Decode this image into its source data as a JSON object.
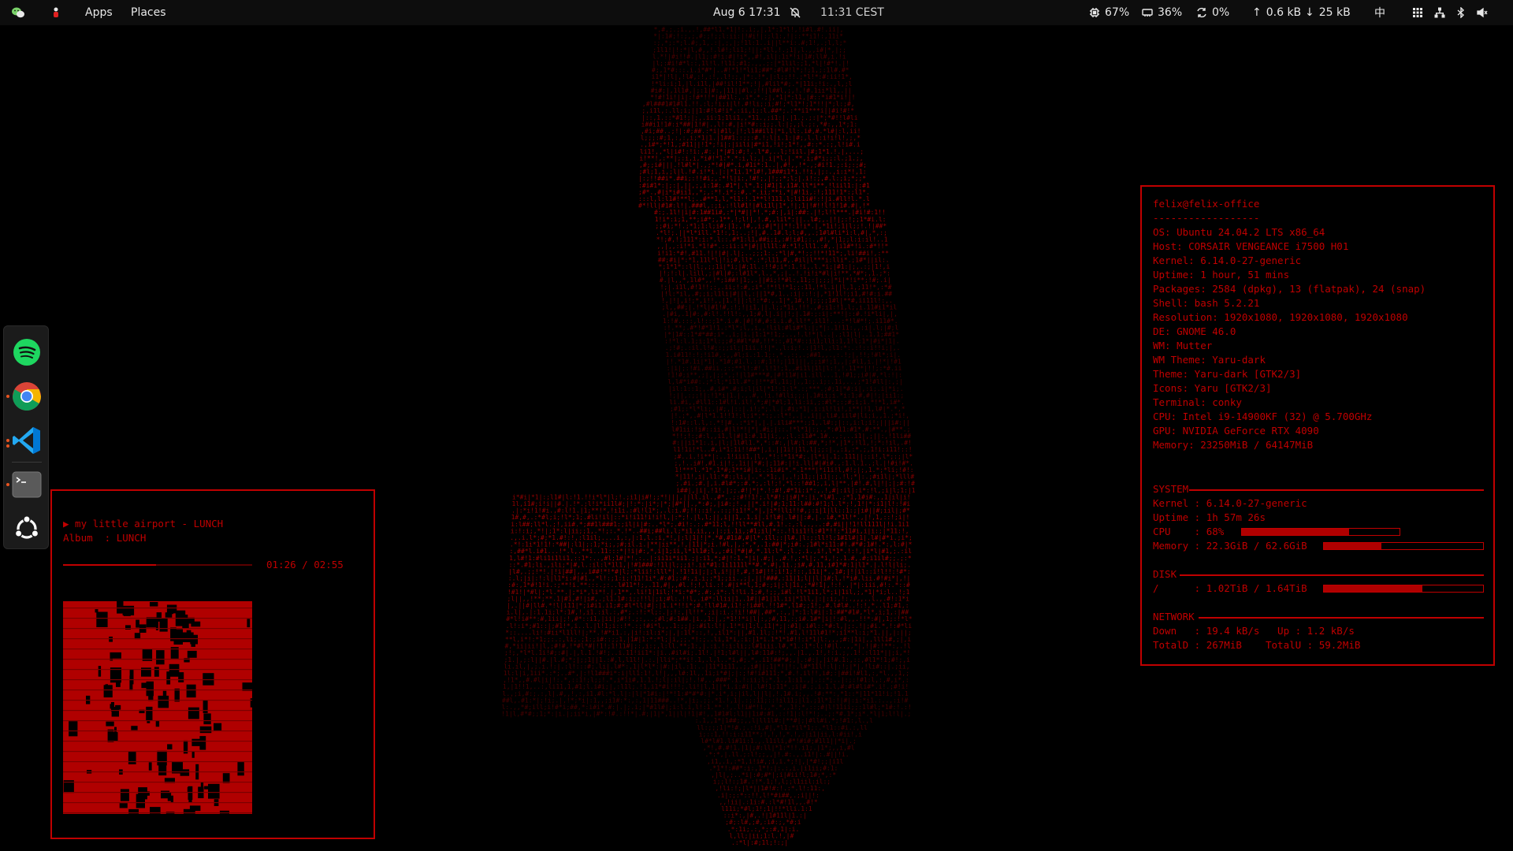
{
  "topbar": {
    "apps_label": "Apps",
    "places_label": "Places",
    "datetime": "Aug 6  17:31",
    "second_clock": "11:31 CEST",
    "tray": {
      "cpu": "67%",
      "ram": "36%",
      "swap": "0%",
      "upload": "0.6 kB",
      "download": "25 kB",
      "input_method": "中"
    }
  },
  "dock": {
    "apps": [
      {
        "name": "spotify-icon",
        "running": false
      },
      {
        "name": "chrome-icon",
        "running": true
      },
      {
        "name": "vscode-icon",
        "running": true
      },
      {
        "name": "terminal-icon",
        "running": true
      },
      {
        "name": "ubuntu-icon",
        "running": false
      }
    ]
  },
  "player": {
    "now_playing": "▶ my little airport - LUNCH",
    "album": "Album  : LUNCH",
    "time": "01:26 / 02:55",
    "progress": 0.49
  },
  "sysinfo": {
    "neofetch": [
      "felix@felix-office",
      "------------------",
      "OS: Ubuntu 24.04.2 LTS x86_64",
      "Host: CORSAIR VENGEANCE i7500 H01",
      "Kernel: 6.14.0-27-generic",
      "Uptime: 1 hour, 51 mins",
      "Packages: 2584 (dpkg), 13 (flatpak), 24 (snap)",
      "Shell: bash 5.2.21",
      "Resolution: 1920x1080, 1920x1080, 1920x1080",
      "DE: GNOME 46.0",
      "WM: Mutter",
      "WM Theme: Yaru-dark",
      "Theme: Yaru-dark [GTK2/3]",
      "Icons: Yaru [GTK2/3]",
      "Terminal: conky",
      "CPU: Intel i9-14900KF (32) @ 5.700GHz",
      "GPU: NVIDIA GeForce RTX 4090",
      "Memory: 23250MiB / 64147MiB"
    ],
    "system": {
      "header": "SYSTEM",
      "kernel": "Kernel : 6.14.0-27-generic",
      "uptime": "Uptime : 1h 57m 26s",
      "cpu": "CPU    : 68%",
      "cpu_fraction": 0.68,
      "memory": "Memory : 22.3GiB / 62.6GiB",
      "memory_fraction": 0.36
    },
    "disk": {
      "header": "DISK",
      "root": "/      : 1.02TiB / 1.64TiB",
      "root_fraction": 0.62
    },
    "network": {
      "header": "NETWORK",
      "speeds": "Down   : 19.4 kB/s   Up : 1.2 kB/s",
      "totals": "TotalD : 267MiB    TotalU : 59.2MiB"
    }
  }
}
